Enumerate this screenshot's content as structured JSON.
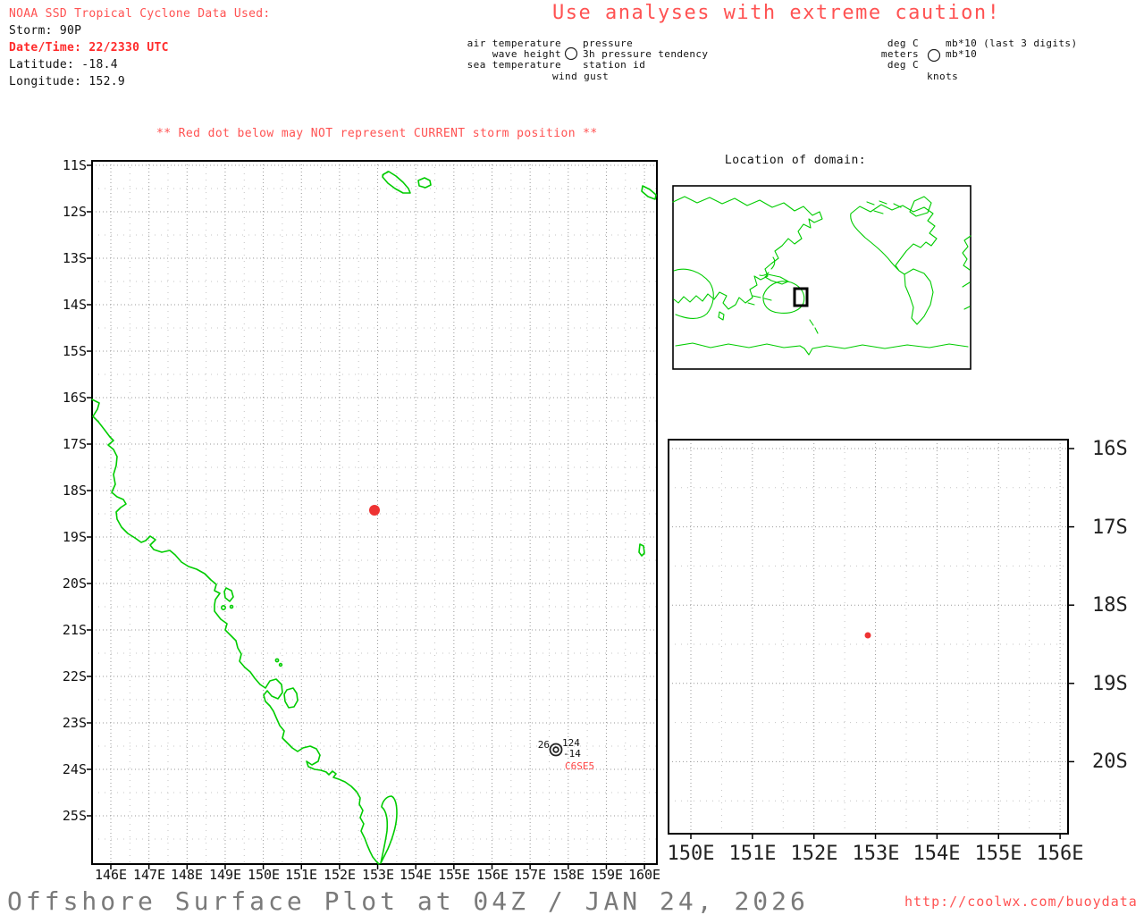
{
  "header": {
    "line1": "NOAA SSD Tropical Cyclone Data Used:",
    "storm": "Storm: 90P",
    "datetime": "Date/Time: 22/2330 UTC",
    "latitude": "Latitude: -18.4",
    "longitude": "Longitude: 152.9"
  },
  "caution": "Use analyses with extreme caution!",
  "station_legend": {
    "r1l": "air temperature",
    "r1r": "pressure",
    "r2l": "wave height",
    "r2r": "3h pressure tendency",
    "r3l": "sea temperature",
    "r3r": "station id",
    "r4": "wind gust"
  },
  "units_legend": {
    "r1l": "deg C",
    "r1r": "mb*10 (last 3 digits)",
    "r2l": "meters",
    "r2r": "mb*10",
    "r3l": "deg C",
    "r4": "knots"
  },
  "warning": "** Red dot below may NOT represent CURRENT storm position **",
  "inset": {
    "title": "Location of domain:"
  },
  "main_map": {
    "lat_labels": [
      "11S",
      "12S",
      "13S",
      "14S",
      "15S",
      "16S",
      "17S",
      "18S",
      "19S",
      "20S",
      "21S",
      "22S",
      "23S",
      "24S",
      "25S"
    ],
    "lon_labels": [
      "146E",
      "147E",
      "148E",
      "149E",
      "150E",
      "151E",
      "152E",
      "153E",
      "154E",
      "155E",
      "156E",
      "157E",
      "158E",
      "159E",
      "160E"
    ],
    "storm_dot": {
      "lat": "-18.4",
      "lon": "152.9"
    },
    "station_plot": {
      "air_temp": "26",
      "pressure": "124",
      "tendency": "-14",
      "id": "C6SE5"
    }
  },
  "sub_map": {
    "lat_labels": [
      "16S",
      "17S",
      "18S",
      "19S",
      "20S"
    ],
    "lon_labels": [
      "150E",
      "151E",
      "152E",
      "153E",
      "154E",
      "155E",
      "156E"
    ],
    "storm_dot": {
      "lat": "-18.4",
      "lon": "152.9"
    }
  },
  "footer": {
    "title": "Offshore Surface Plot at 04Z / JAN 24, 2026",
    "url": "http://coolwx.com/buoydata"
  },
  "colors": {
    "red_text": "#ff5252",
    "red_bold": "#ff2a2a",
    "coast_green": "#00cc00",
    "storm_dot": "#ee3333",
    "title_gray": "#7a7a7a"
  }
}
